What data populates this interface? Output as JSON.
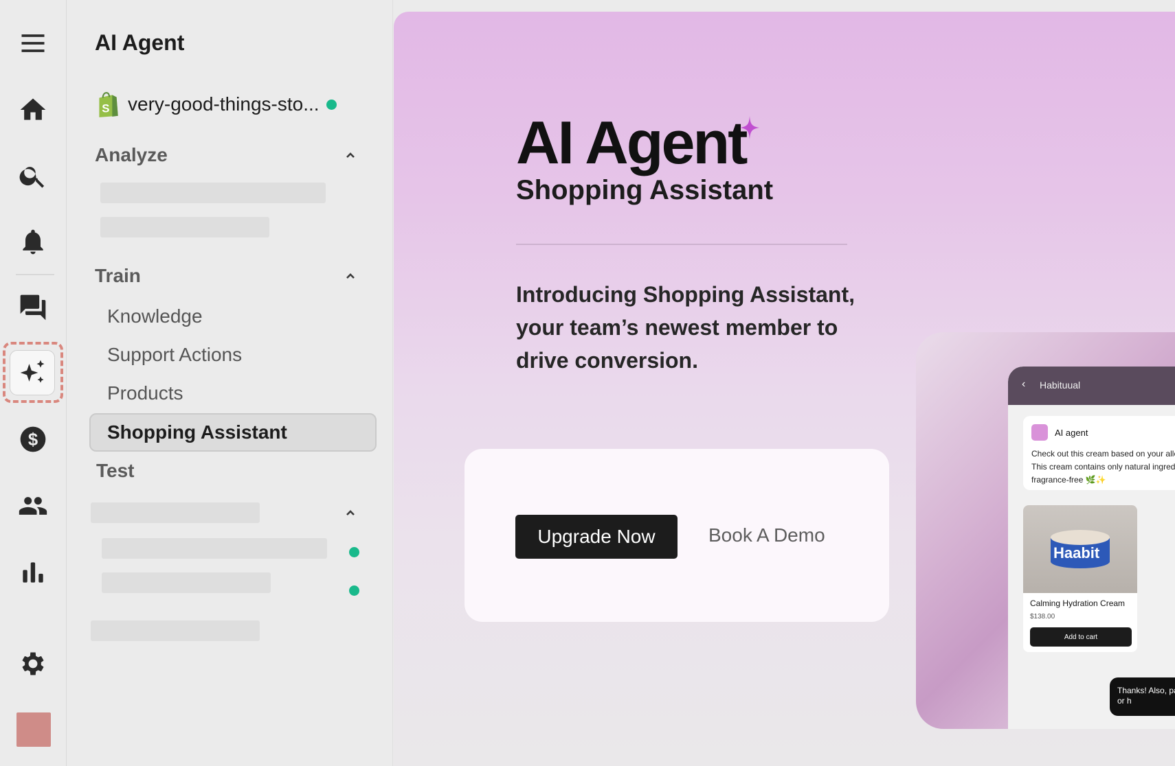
{
  "rail": {
    "icons": [
      "menu-icon",
      "home-icon",
      "search-icon",
      "bell-icon",
      "chat-icon",
      "sparkles-icon",
      "dollar-icon",
      "people-icon",
      "bar-chart-icon",
      "gear-icon"
    ]
  },
  "nav": {
    "title": "AI Agent",
    "store": {
      "name": "very-good-things-sto...",
      "status_color": "#19b98b"
    },
    "sections": {
      "analyze": "Analyze",
      "train": "Train",
      "test": "Test"
    },
    "train_items": [
      "Knowledge",
      "Support Actions",
      "Products"
    ],
    "active_item": "Shopping Assistant"
  },
  "hero": {
    "title": "AI Agent",
    "subtitle": "Shopping Assistant",
    "intro": "Introducing Shopping Assistant, your team’s newest member to drive conversion.",
    "upgrade_label": "Upgrade Now",
    "demo_label": "Book A Demo"
  },
  "preview": {
    "brand": "Habituual",
    "agent_name": "AI agent",
    "agent_message": "Check out this cream based on your allergy needs. This cream contains only natural ingredients and is fragrance-free 🌿✨",
    "product_brand": "Haabit",
    "product_name": "Calming Hydration Cream",
    "product_price": "$138.00",
    "add_to_cart": "Add to cart",
    "reply": "Thanks! Also, parabens or h"
  },
  "colors": {
    "accent_dot": "#19b98b",
    "sparkle": "#c04fd0",
    "highlight": "#d9877e"
  }
}
